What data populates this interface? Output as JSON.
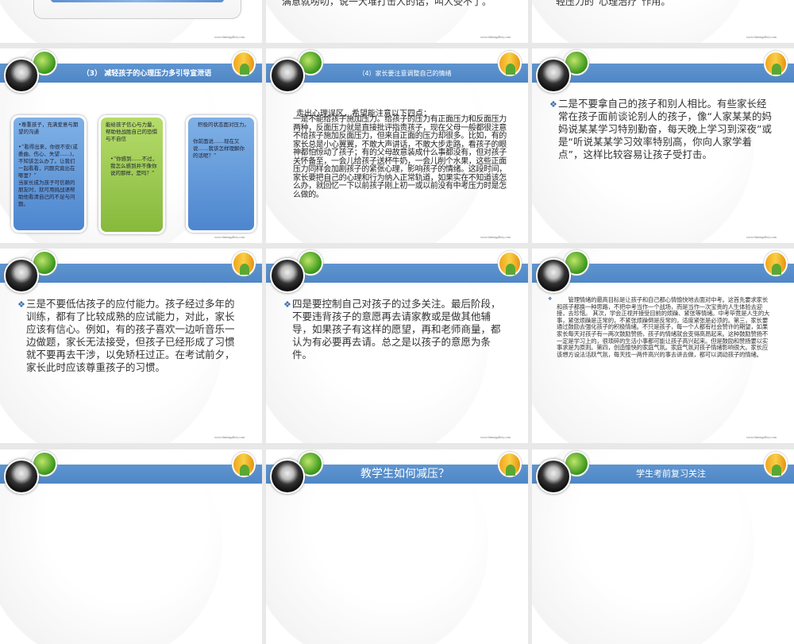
{
  "watermark": "www.themegallery.com",
  "slides": [
    {
      "text": ""
    },
    {
      "text": "满意就唠叨，说一大堆打击人的话，叫人受不了。"
    },
    {
      "text": "轻压力的“心理治疗”作用。"
    },
    {
      "title": "（3） 减轻孩子的心理压力多引导宣泄语",
      "boxes": [
        {
          "head": "•尊重孩子，充满爱意与期望的沟通",
          "body": "•“看得出来，你很不安(或委曲、伤心、失望……)，不知该怎么办了。让我们一起看看，问题究竟出在哪里？”",
          "extra": "当家长成为孩子可信赖的朋友时，就可用挑战语帮助他看清自己的不足与问题。"
        },
        {
          "head": "能给孩子信心与力量，帮助他战胜自己的恐惧与不自信",
          "body": "•“你感到……不过，我怎么感到并不像你说的那样，是吗？”"
        },
        {
          "head": "积极的状态面对压力。",
          "body": "你前面说……现在又说……我该怎样理解你的话呢？”"
        }
      ]
    },
    {
      "title": "（4）家长要注意调整自己的情绪",
      "heading": "走出心理误区，希望能注意以下四点：",
      "text": "一是不能给孩子施加压力。给孩子的压力有正面压力和反面压力两种，反面压力就是直接批评指责孩子，现在父母一般都很注意不给孩子施加反面压力，但来自正面的压力却很多。比如，有的家长总是小心翼翼，不敢大声讲话，不敢大步走路，看孩子的眼神都怕惊动了孩子；有的父母故意装成什么事都没有，但对孩子关怀备至，一会儿给孩子送杯牛奶，一会儿削个水果，这些正面压力同样会加剧孩子的紧张心理，影响孩子的情绪。这段时间，家长要把自己的心理和行为纳入正常轨道，如果实在不知道该怎么办，就回忆一下以前孩子刚上初一或以前没有中考压力时是怎么做的。"
    },
    {
      "text": "二是不要拿自己的孩子和别人相比。有些家长经常在孩子面前谈论别人的孩子，像“人家某某的妈妈说某某学习特别勤奋，每天晚上学习到深夜”或是“听说某某学习效率特别高，你向人家学着点”，这样比较容易让孩子受打击。"
    },
    {
      "text": "三是不要低估孩子的应付能力。孩子经过多年的训练，都有了比较成熟的应试能力，对此，家长应该有信心。例如，有的孩子喜欢一边听音乐一边做题，家长无法接受，但孩子已经形成了习惯就不要再去干涉，以免矫枉过正。在考试前夕，家长此时应该尊重孩子的习惯。"
    },
    {
      "text": "四是要控制自己对孩子的过多关注。最后阶段，不要违背孩子的意愿再去请家教或是做其他辅导，如果孩子有这样的愿望，再和老师商量，都认为有必要再去请。总之是以孩子的意愿为条件。"
    },
    {
      "text": "　　管理情绪的最高目标是让孩子和自己都心情愉快地去面对中考。这首先要求家长和孩子都换一种思路，不把中考当作一个战场，而是当作一次宝贵的人生体验去迎接，去珍惜。 其次，学会正视并接受目前的烦躁、紧张等情绪。中考毕竟是人生的大事，紧张烦躁是正常的，不紧张烦躁倒是反常的，适度紧张是必须的。第三，家长要通过鼓励去强化孩子的积极情绪。不只是孩子，每一个人都有社会赞许的期望，如果家长每天对孩子有一两次鼓励赞扬，孩子的情绪就会变得高昂起来。这种鼓励赞扬不一定是学习上的，很琐碎的生活小事都可能让孩子高兴起来。但是鼓励和赞扬要以实事求是为原则。第四，创造愉快的家庭气氛。家庭气氛对孩子情绪影响很大。家长应该想方设法活跃气氛，每天找一两件高兴的事去讲去做，都可以调动孩子的情绪。"
    },
    {
      "title": ""
    },
    {
      "title": "教学生如何减压？"
    },
    {
      "title": "学生考前复习关注"
    }
  ]
}
